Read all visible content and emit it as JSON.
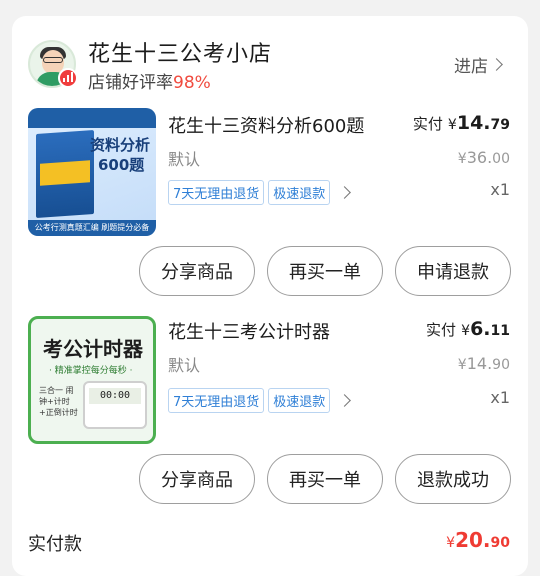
{
  "shop": {
    "name": "花生十三公考小店",
    "rating_label": "店铺好评率",
    "rating_value": "98%",
    "enter_label": "进店"
  },
  "products": [
    {
      "title": "花生十三资料分析600题",
      "spec": "默认",
      "paid_label": "实付",
      "paid_currency": "¥",
      "paid_int": "14.",
      "paid_dec": "79",
      "orig_currency": "¥",
      "orig_int": "36.",
      "orig_dec": "00",
      "tag_return": "7天无理由退货",
      "tag_fast": "极速退款",
      "qty": "x1",
      "thumb_text": {
        "line1": "资料分析",
        "line2": "600题",
        "footer": "公考行测真题汇编 刷题提分必备"
      },
      "buttons": [
        "分享商品",
        "再买一单",
        "申请退款"
      ]
    },
    {
      "title": "花生十三考公计时器",
      "spec": "默认",
      "paid_label": "实付",
      "paid_currency": "¥",
      "paid_int": "6.",
      "paid_dec": "11",
      "orig_currency": "¥",
      "orig_int": "14.",
      "orig_dec": "90",
      "tag_return": "7天无理由退货",
      "tag_fast": "极速退款",
      "qty": "x1",
      "thumb_text": {
        "title": "考公计时器",
        "subtitle": "· 精准掌控每分每秒 ·",
        "note": "三合一 闹钟+计时 +正倒计时",
        "screen": "00:00"
      },
      "buttons": [
        "分享商品",
        "再买一单",
        "退款成功"
      ]
    }
  ],
  "total": {
    "label": "实付款",
    "currency": "¥",
    "int": "20.",
    "dec": "90"
  },
  "colors": {
    "accent_red": "#ef3b33",
    "tag_blue": "#2f7fd6",
    "rating_red": "#f04b3f"
  }
}
